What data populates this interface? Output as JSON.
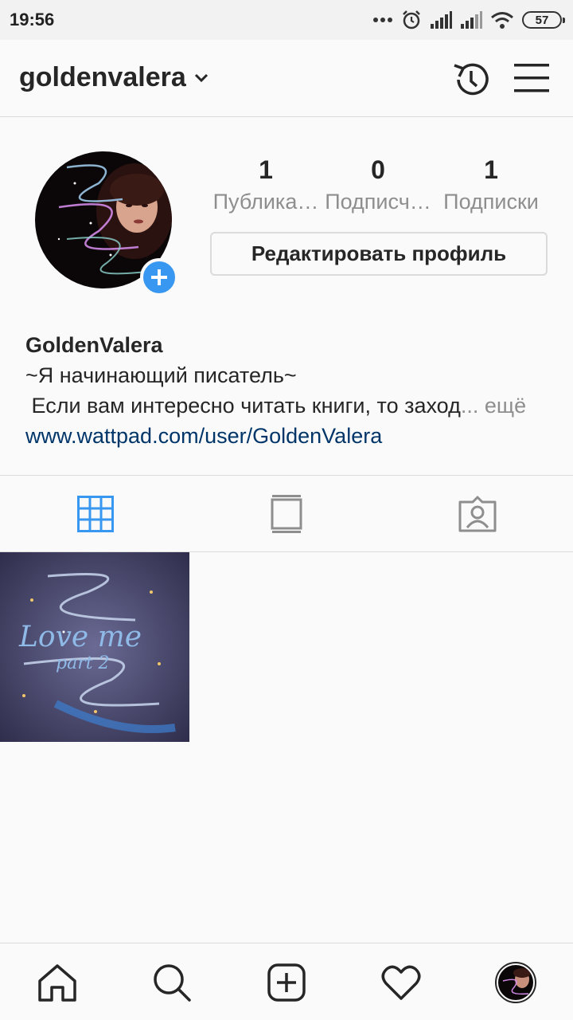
{
  "status_bar": {
    "time": "19:56",
    "battery": "57",
    "icons": [
      "more-dots-icon",
      "alarm-icon",
      "signal-icon",
      "signal-icon",
      "wifi-icon",
      "battery-icon"
    ]
  },
  "header": {
    "username": "goldenvalera",
    "icons": [
      "chevron-down-icon",
      "history-icon",
      "menu-icon"
    ]
  },
  "profile": {
    "stats": [
      {
        "count": "1",
        "label": "Публика…"
      },
      {
        "count": "0",
        "label": "Подписч…"
      },
      {
        "count": "1",
        "label": "Подписки"
      }
    ],
    "edit_button": "Редактировать профиль",
    "name": "GoldenValera",
    "bio_line1": "~Я начинающий писатель~",
    "bio_line2": " Если вам интересно читать книги, то заход",
    "bio_more": "... ещё",
    "link": "www.wattpad.com/user/GoldenValera"
  },
  "tabs": [
    {
      "icon": "grid-icon",
      "active": true
    },
    {
      "icon": "feed-icon",
      "active": false
    },
    {
      "icon": "tagged-icon",
      "active": false
    }
  ],
  "posts": [
    {
      "caption_line1": "Love me",
      "caption_line2": "part 2"
    }
  ],
  "bottom_nav": [
    "home-icon",
    "search-icon",
    "new-post-icon",
    "activity-icon",
    "profile-icon"
  ],
  "colors": {
    "accent": "#3897f0",
    "link": "#003569",
    "muted": "#8e8e8e",
    "text": "#262626"
  }
}
